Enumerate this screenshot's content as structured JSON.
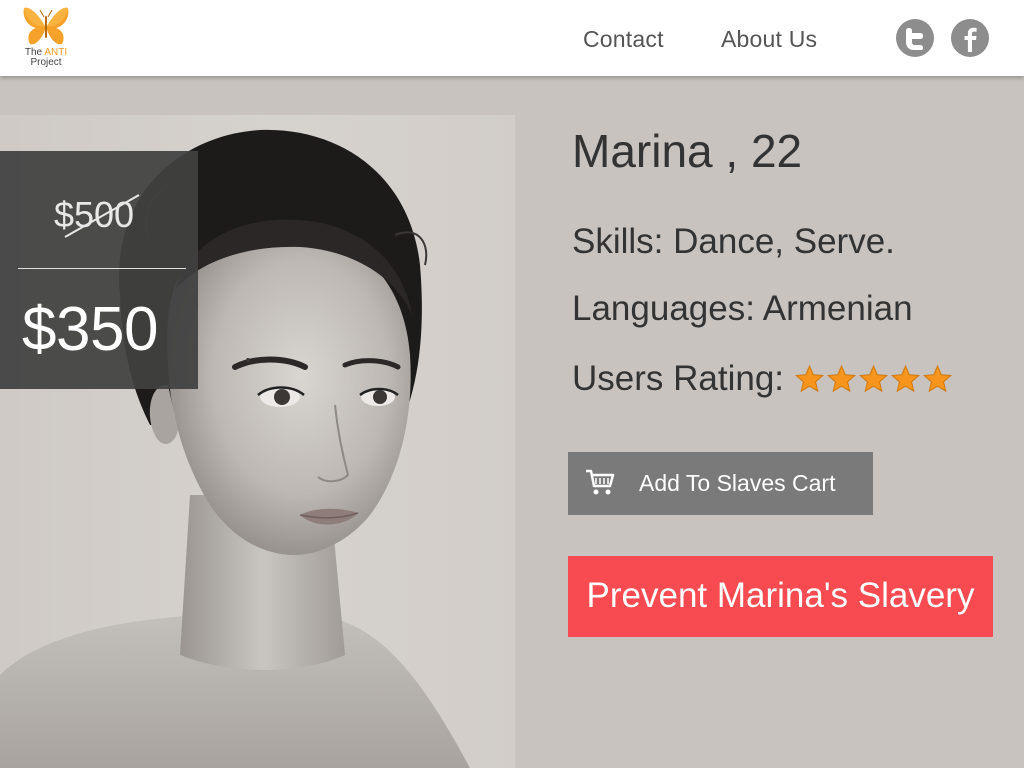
{
  "header": {
    "logo": {
      "line1_prefix": "The ",
      "line1_accent": "ANTI",
      "line2": "Project",
      "icon": "butterfly-icon"
    },
    "nav": {
      "contact": "Contact",
      "about": "About Us"
    },
    "social": {
      "twitter_icon": "twitter-icon",
      "facebook_icon": "facebook-icon"
    }
  },
  "price": {
    "old": "$500",
    "new": "$350"
  },
  "profile": {
    "name_age": "Marina , 22",
    "skills": "Skills: Dance, Serve.",
    "languages": "Languages: Armenian",
    "rating_label": "Users Rating:",
    "rating": 5,
    "rating_max": 5
  },
  "actions": {
    "cart_label": "Add To Slaves Cart",
    "cart_icon": "shopping-cart-icon",
    "prevent_label": "Prevent Marina's Slavery"
  },
  "colors": {
    "page_bg": "#c8c3bf",
    "header_bg": "#ffffff",
    "price_box_bg": "#414141",
    "cart_button_bg": "#7a7a7a",
    "prevent_button_bg": "#f84b51",
    "star": "#f7941d",
    "logo_accent": "#f39a1e"
  }
}
